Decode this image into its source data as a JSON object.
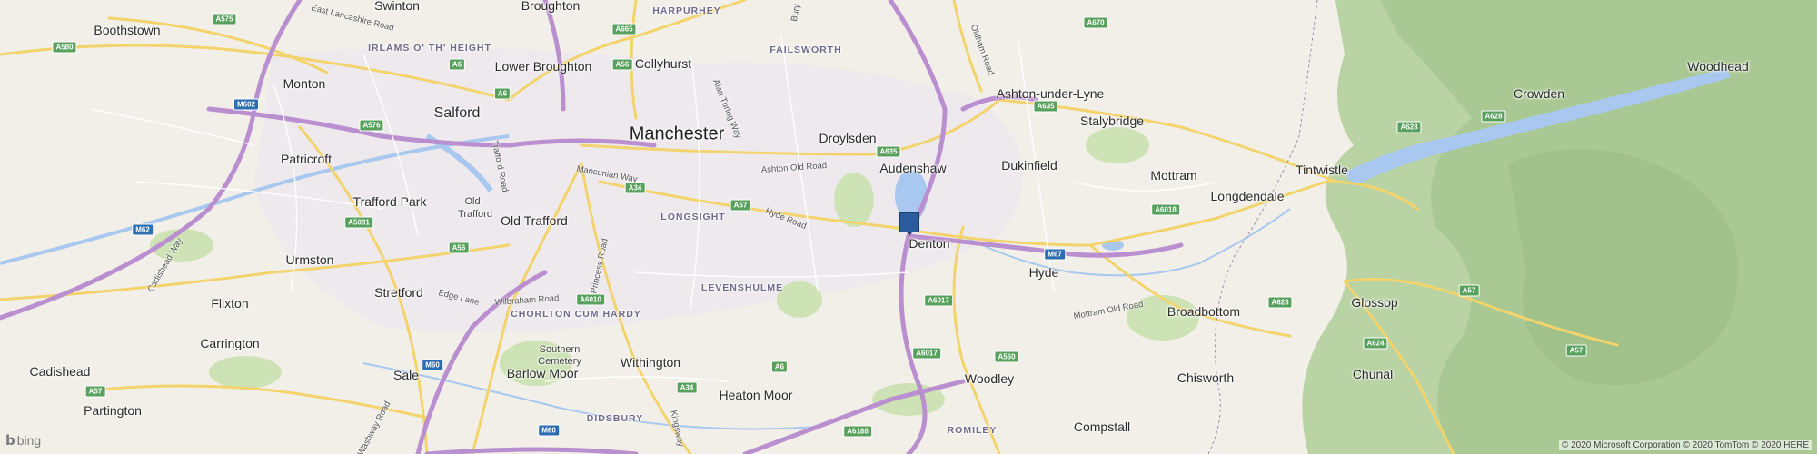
{
  "map": {
    "provider": "bing",
    "colors": {
      "land": "#f2efe9",
      "water": "#a8c8ef",
      "hills": "#b9d3a4",
      "motorway": "#b98fcf",
      "main_road": "#f3d36b",
      "green": "#cde3b6"
    },
    "pin": {
      "name": "Denton",
      "color": "#2b5c9e"
    },
    "places": {
      "swinton": "Swinton",
      "broughton": "Broughton",
      "harpurhey": "HARPURHEY",
      "boothstown": "Boothstown",
      "irlams": "IRLAMS O' TH' HEIGHT",
      "lower_broughton": "Lower Broughton",
      "collyhurst": "Collyhurst",
      "failsworth": "FAILSWORTH",
      "ashton_under_lyne": "Ashton-under-Lyne",
      "stalybridge": "Stalybridge",
      "crowden": "Crowden",
      "woodhead": "Woodhead",
      "monton": "Monton",
      "salford": "Salford",
      "manchester": "Manchester",
      "droylsden": "Droylsden",
      "patricroft": "Patricroft",
      "audenshaw": "Audenshaw",
      "dukinfield": "Dukinfield",
      "mottram": "Mottram",
      "longdendale": "Longdendale",
      "tintwistle": "Tintwistle",
      "trafford_park": "Trafford Park",
      "old_trafford_upper": "Old",
      "old_trafford_lower": "Trafford",
      "old_trafford": "Old Trafford",
      "longsight": "LONGSIGHT",
      "denton": "Denton",
      "hyde": "Hyde",
      "urmston": "Urmston",
      "levenshulme": "LEVENSHULME",
      "stretford": "Stretford",
      "chorlton": "CHORLTON CUM HARDY",
      "broadbottom": "Broadbottom",
      "glossop": "Glossop",
      "flixton": "Flixton",
      "carrington": "Carrington",
      "southern_cemetery_1": "Southern",
      "southern_cemetery_2": "Cemetery",
      "withington": "Withington",
      "barlow_moor": "Barlow Moor",
      "cadishead": "Cadishead",
      "sale": "Sale",
      "woodley": "Woodley",
      "chisworth": "Chisworth",
      "chunal": "Chunal",
      "heaton_moor": "Heaton Moor",
      "partington": "Partington",
      "didsbury": "DIDSBURY",
      "romiley": "ROMILEY",
      "compstall": "Compstall"
    },
    "roads": {
      "east_lancashire_road": "East Lancashire Road",
      "oldham_road": "Oldham Road",
      "alan_turing_way": "Alan Turing Way",
      "bury_new_road": "Bury",
      "trafford_road": "Trafford Road",
      "mancunian_way": "Mancunian Way",
      "ashton_old_road": "Ashton Old Road",
      "hyde_road": "Hyde Road",
      "princess_road": "Princess Road",
      "cadishead_way": "Cadishead Way",
      "edge_lane": "Edge Lane",
      "wilbraham_road": "Wilbraham Road",
      "mottram_old_road": "Mottram Old Road",
      "washway_road": "Washway Road",
      "kingsway": "Kingsway"
    },
    "shields": {
      "a575": "A575",
      "a665": "A665",
      "a670": "A670",
      "a580": "A580",
      "a6_north": "A6",
      "a56_north": "A56",
      "a6_salford": "A6",
      "a635_east": "A635",
      "m602": "M602",
      "a576": "A576",
      "a635": "A635",
      "a628_west": "A628",
      "a628_east": "A628",
      "a34_city": "A34",
      "a57": "A57",
      "a6018": "A6018",
      "a5081": "A5081",
      "m67": "M67",
      "m62": "M62",
      "a56": "A56",
      "a6010": "A6010",
      "a6017_north": "A6017",
      "a628": "A628",
      "a57_glossop": "A57",
      "a624": "A624",
      "a6017_south": "A6017",
      "a560": "A560",
      "a57_east": "A57",
      "a6_south": "A6",
      "m60_west": "M60",
      "a34_south": "A34",
      "a57_partington": "A57",
      "a6188": "A6188",
      "m60_south": "M60"
    },
    "logo": "bing",
    "copyright": "© 2020 Microsoft Corporation © 2020 TomTom © 2020 HERE"
  }
}
